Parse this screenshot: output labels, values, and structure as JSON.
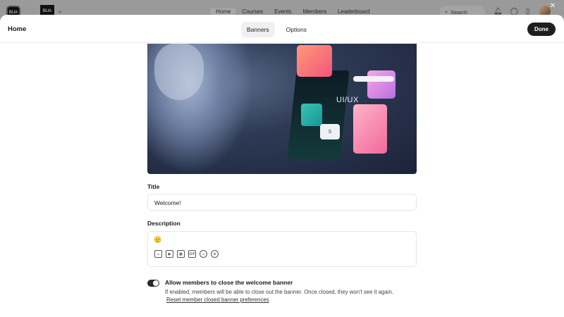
{
  "background": {
    "logo_text": "BUA",
    "logo2_text": "BUA",
    "nav": [
      "Home",
      "Courses",
      "Events",
      "Members",
      "Leaderboard"
    ],
    "active_nav": "Home",
    "search_label": "Search"
  },
  "modal": {
    "title": "Home",
    "tabs": [
      {
        "label": "Banners",
        "active": true
      },
      {
        "label": "Options",
        "active": false
      }
    ],
    "done_label": "Done"
  },
  "banner": {
    "image_text": "UI/UX",
    "sketch_text": "S"
  },
  "form": {
    "title_label": "Title",
    "title_value": "Welcome!",
    "description_label": "Description",
    "description_emoji": "🫡",
    "toolbar_icons": [
      "emoji-icon",
      "video-icon",
      "image-icon",
      "gif-icon",
      "smiley-icon",
      "attachment-icon"
    ],
    "gif_text": "GIF"
  },
  "toggle": {
    "enabled": true,
    "label": "Allow members to close the welcome banner",
    "help": "If enabled, members will be able to close out the banner. Once closed, they won't see it again.",
    "reset_link": "Reset member closed banner preferences"
  }
}
